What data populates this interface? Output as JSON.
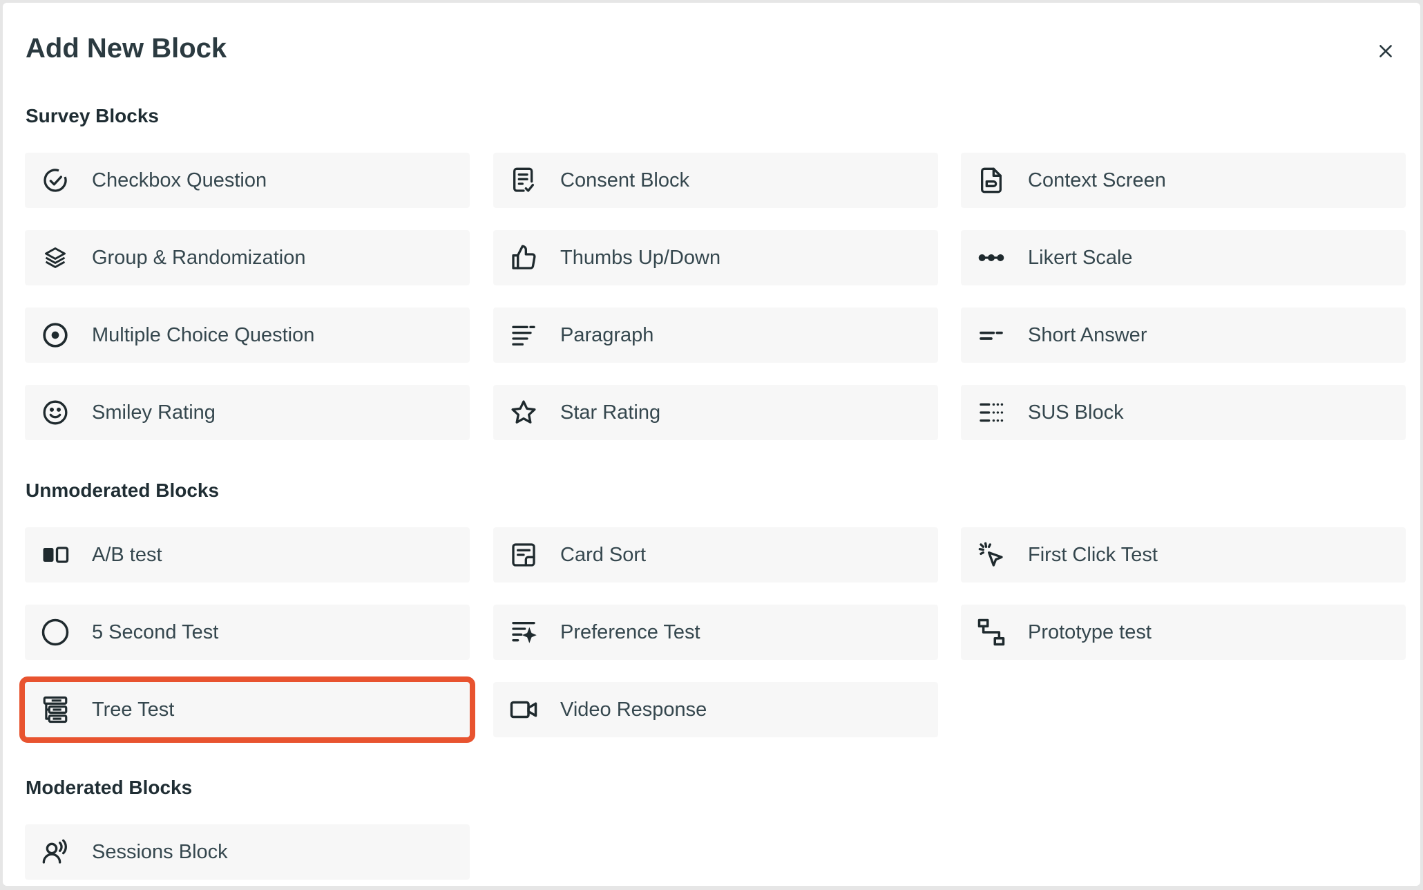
{
  "dialog": {
    "title": "Add New Block",
    "close_icon": "close-icon"
  },
  "sections": [
    {
      "title": "Survey Blocks",
      "blocks": [
        {
          "label": "Checkbox Question",
          "icon": "check-circle-icon"
        },
        {
          "label": "Consent Block",
          "icon": "document-check-icon"
        },
        {
          "label": "Context Screen",
          "icon": "document-icon"
        },
        {
          "label": "Group & Randomization",
          "icon": "layers-icon"
        },
        {
          "label": "Thumbs Up/Down",
          "icon": "thumbs-up-icon"
        },
        {
          "label": "Likert Scale",
          "icon": "likert-dots-icon"
        },
        {
          "label": "Multiple Choice Question",
          "icon": "radio-icon"
        },
        {
          "label": "Paragraph",
          "icon": "paragraph-icon"
        },
        {
          "label": "Short Answer",
          "icon": "short-answer-icon"
        },
        {
          "label": "Smiley Rating",
          "icon": "smiley-icon"
        },
        {
          "label": "Star Rating",
          "icon": "star-icon"
        },
        {
          "label": "SUS Block",
          "icon": "sus-list-icon"
        }
      ]
    },
    {
      "title": "Unmoderated Blocks",
      "blocks": [
        {
          "label": "A/B test",
          "icon": "ab-test-icon"
        },
        {
          "label": "Card Sort",
          "icon": "card-sort-icon"
        },
        {
          "label": "First Click Test",
          "icon": "cursor-click-icon"
        },
        {
          "label": "5 Second Test",
          "icon": "circle-icon"
        },
        {
          "label": "Preference Test",
          "icon": "preference-icon"
        },
        {
          "label": "Prototype test",
          "icon": "flow-icon"
        },
        {
          "label": "Tree Test",
          "icon": "tree-test-icon",
          "highlighted": true
        },
        {
          "label": "Video Response",
          "icon": "video-icon"
        }
      ]
    },
    {
      "title": "Moderated Blocks",
      "blocks": [
        {
          "label": "Sessions Block",
          "icon": "person-voice-icon"
        }
      ]
    }
  ],
  "colors": {
    "highlight": "#e8532f",
    "tile_bg": "#f7f7f7",
    "text": "#35474e",
    "heading": "#1f2d33"
  }
}
